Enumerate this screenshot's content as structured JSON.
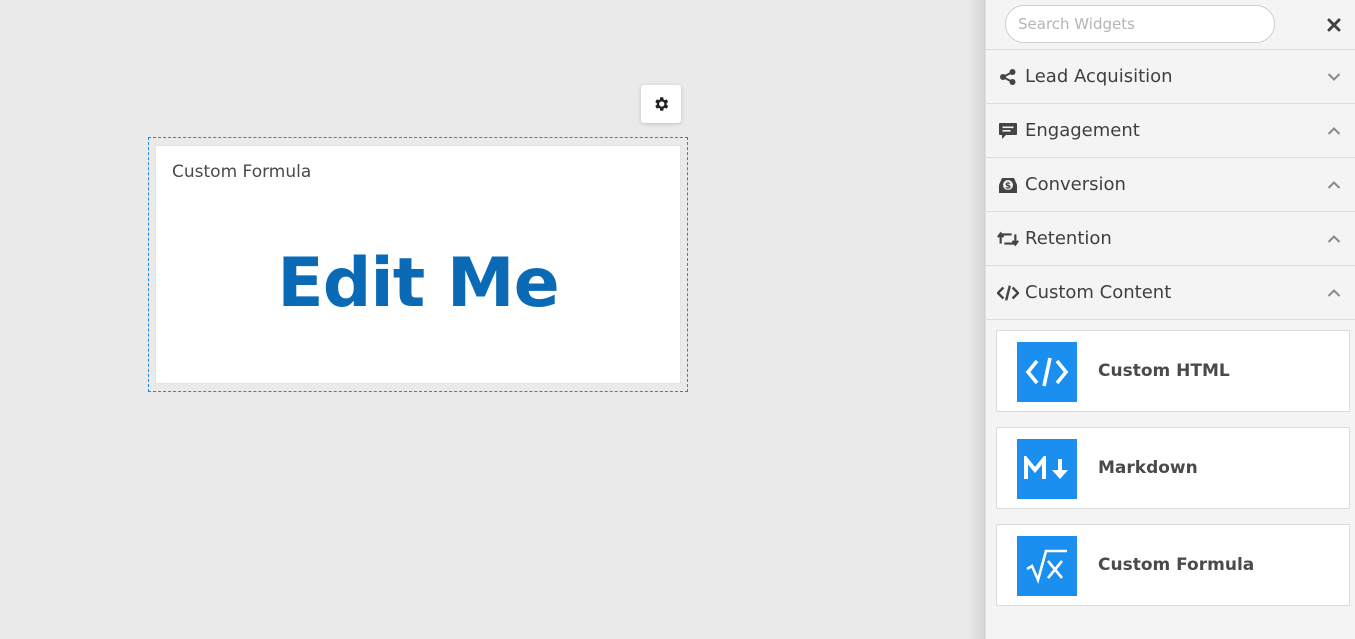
{
  "canvas": {
    "widget": {
      "title": "Custom Formula",
      "value": "Edit Me"
    },
    "settings_icon": "gear-icon"
  },
  "sidebar": {
    "search": {
      "value": "",
      "placeholder": "Search Widgets"
    },
    "close_icon": "close-icon",
    "categories": [
      {
        "label": "Lead Acquisition",
        "icon": "share-icon",
        "state": "collapsed"
      },
      {
        "label": "Engagement",
        "icon": "comment-icon",
        "state": "expanded"
      },
      {
        "label": "Conversion",
        "icon": "dollar-tray-icon",
        "state": "expanded"
      },
      {
        "label": "Retention",
        "icon": "retweet-icon",
        "state": "expanded"
      },
      {
        "label": "Custom Content",
        "icon": "code-icon",
        "state": "expanded"
      }
    ],
    "widgets": [
      {
        "label": "Custom HTML",
        "icon": "code-icon"
      },
      {
        "label": "Markdown",
        "icon": "markdown-icon"
      },
      {
        "label": "Custom Formula",
        "icon": "square-root-icon"
      }
    ],
    "accent_color": "#1a8ff0"
  },
  "colors": {
    "edit_me": "#0a6ab6",
    "selection_border": "#1e88e5"
  }
}
